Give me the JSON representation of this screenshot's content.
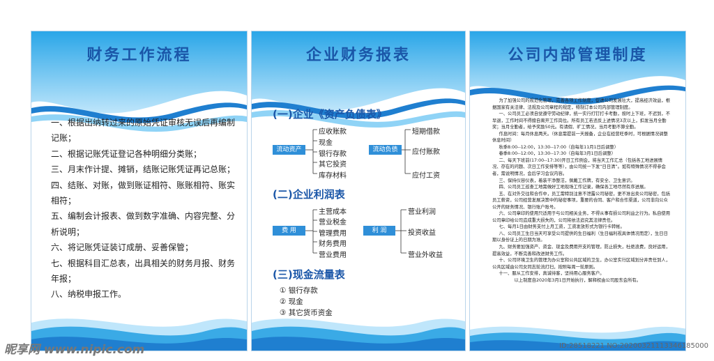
{
  "colors": {
    "title": "#1a56a8",
    "accent": "#2f8fd8",
    "wave": "#3aaae6"
  },
  "board1": {
    "title": "财务工作流程",
    "items": [
      "一、根据出纳转过来的原始凭证审核无误后再编制记账；",
      "二、根据记账凭证登记各种明细分类账；",
      "三、月末作计提、摊销，结账记账凭证再记总账；",
      "四、结账、对账，做到账证相符、账账相符、账实相符；",
      "五、编制会计报表、做到数字准确、内容完整、分析说明；",
      "六、将记账凭证装订成册、妥善保管；",
      "七、根据科目汇总表，出具相关的财务月报、财务年报；",
      "八、纳税申报工作。"
    ]
  },
  "board2": {
    "title": "企业财务报表",
    "sec1": "(一)企业《资产负债表》",
    "asset_tag": "流动资产",
    "assets": [
      "应收账款",
      "现金",
      "银行存款",
      "其它投资",
      "库存材料"
    ],
    "liab_tag": "流动负债",
    "liabs": [
      "短期借款",
      "应付账款",
      "应付工资"
    ],
    "sec2": "(二)企业利润表",
    "cost_tag": "费  用",
    "costs": [
      "主营成本",
      "营业税金",
      "管理费用",
      "财务费用",
      "营业费用"
    ],
    "profit_tag": "利  润",
    "profits": [
      "营业利润",
      "投资收益",
      "营业外收益"
    ],
    "sec3": "(三)现金流量表",
    "cash": [
      "① 银行存款",
      "② 现金",
      "③ 其它货币资金"
    ]
  },
  "board3": {
    "title": "公司内部管理制度",
    "paras": [
      "为了加强公司的规范化管理，完善各项工作制度，促进公司发展壮大，提高经济效益，根据国家有关法律、法规及公司章程的规定，特制订本公司内部管理制度。",
      "一、公司员工必须自觉遵守劳动纪律，统一实行打钉打卡考勤，按时上下班，不迟到，不早退，工作时间不得擅自离开工作岗位。所有员工若违反上述情况3次以上，扣发当月全勤奖；当月全勤者，给予奖励50元。有请假、旷工情况，当月考勤不算全勤。",
      "作息时间：每月休息两天。（休息需提前一天报备，企业在经营旺季时，可根据情况调整休息时间）",
      "秋季8:00--12:00，13:30--17:00（自每年11月1日后调整）",
      "春季8:00--12:00，13:30--17:30（自每年3月1日后调整）",
      "二、每天下班前(17:00--17:30)开日工作例会，将当天工作汇总（包括各工地进展情况、存在的问题、次日工作安排等等），由公司统一下发“日日清”。如有特殊情况不得参会者，需说明情况，会后学习会议内容。",
      "三、保持仪容仪表，着装干净整洁，佩戴工作牌，有安全、卫生意识。",
      "四、公司员工巡查工地需做好工地现场工作记录，确保各工地尽然有序进展。",
      "五、在对外交往和合作中，员工需特别注意不泄露公司秘密，更不准出卖公司秘密，包括员工薪资，公司经营发展决策中的秘密事项，重要的合同、客户和合作渠道，公司非向公众公开的财务情况、银行账户账号。",
      "六、公司章印的使用只适用于与公司相关业务，不得从事有损公司利益之行为。私自使用公司章印给公司造成重大损失的，公司将依法追究其法律责任。",
      "七、每月1日由财务支付上月工资，工资发放形式为银行卡转帐。",
      "八、公司员工生日当天可享受公司提供的生日福利（生日福利视具体情况而定），生日日期以身份证上的日期为准。",
      "九、财务要加强资产、资金、现金及费用开支的管理，防止损失，杜绝浪费，良好运用，提高效益，不断完善和改进财务工作。",
      "十、公司环境卫生的管理为办公室和公共区域的卫生，办公室实行区域划分并责任到人，公共区域由公司女同志轮流打扫，按照每周一轮原则。",
      "十一、服从工作安排，真诚待客，坚持用心服务客户。",
      "以上制度自2020年3月1日开始执行，解释权由公司股东会所有。"
    ]
  },
  "watermark": {
    "left": "昵享网 www.nipic.com",
    "right": "ID:28518221 NO:20200321113346185000"
  }
}
